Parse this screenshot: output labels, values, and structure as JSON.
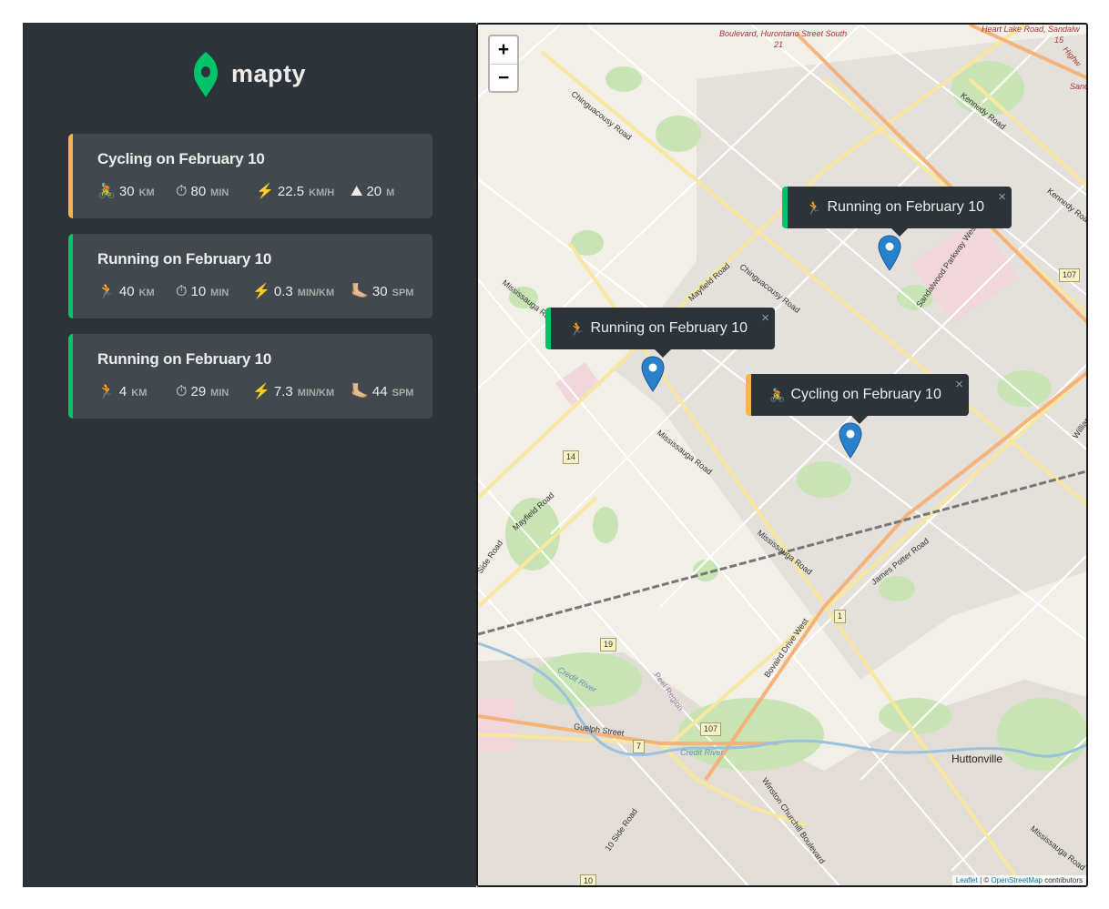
{
  "app": {
    "name": "mapty"
  },
  "workouts": [
    {
      "type": "cycling",
      "title": "Cycling on February 10",
      "details": [
        {
          "icon": "🚴",
          "value": "30",
          "unit": "km"
        },
        {
          "icon": "⏱",
          "value": "80",
          "unit": "min"
        },
        {
          "icon": "⚡️",
          "value": "22.5",
          "unit": "km/h"
        },
        {
          "icon": "⛰",
          "value": "20",
          "unit": "m"
        }
      ]
    },
    {
      "type": "running",
      "title": "Running on February 10",
      "details": [
        {
          "icon": "🏃",
          "value": "40",
          "unit": "km"
        },
        {
          "icon": "⏱",
          "value": "10",
          "unit": "min"
        },
        {
          "icon": "⚡️",
          "value": "0.3",
          "unit": "min/km"
        },
        {
          "icon": "🦶🏼",
          "value": "30",
          "unit": "spm"
        }
      ]
    },
    {
      "type": "running",
      "title": "Running on February 10",
      "details": [
        {
          "icon": "🏃",
          "value": "4",
          "unit": "km"
        },
        {
          "icon": "⏱",
          "value": "29",
          "unit": "min"
        },
        {
          "icon": "⚡️",
          "value": "7.3",
          "unit": "min/km"
        },
        {
          "icon": "🦶🏼",
          "value": "44",
          "unit": "spm"
        }
      ]
    }
  ],
  "map": {
    "zoom_in": "+",
    "zoom_out": "−",
    "popups": [
      {
        "type": "running",
        "icon": "🏃",
        "text": "Running on February 10",
        "close": "×"
      },
      {
        "type": "running",
        "icon": "🏃",
        "text": "Running on February 10",
        "close": "×"
      },
      {
        "type": "cycling",
        "icon": "🚴",
        "text": "Cycling on February 10",
        "close": "×"
      }
    ],
    "labels": {
      "chinguacousy": "Chinguacousy Road",
      "chinguacousy2": "Chinguacousy Road",
      "mayfield": "Mayfield Road",
      "mayfield2": "Mayfield Road",
      "mississauga1": "Mississauga Road",
      "mississauga2": "Mississauga Road",
      "mississauga3": "Mississauga Road",
      "mississauga4": "Mississauga Road",
      "kennedy": "Kennedy Road",
      "kennedy2": "Kennedy Road",
      "sandalwood": "Sandalwood Parkway West",
      "williams": "Williams Parkway",
      "james_potter": "James Potter Road",
      "bovaird": "Bovaird Drive West",
      "guelph": "Guelph Street",
      "winston": "Winston Churchill Boulevard",
      "tenth_side": "10 Side Road",
      "credit_river": "Credit River",
      "credit_river2": "Credit River",
      "peel_region": "Peel Region",
      "hurontario": "Boulevard, Hurontario Street South",
      "heart_lake": "Heart Lake Road, Sandalw",
      "side_road": "Side Road",
      "huttonville": "Huttonville",
      "s21": "21",
      "s15": "15",
      "sand": "Sand",
      "highway": "Highw"
    },
    "shields": {
      "r107a": "107",
      "r107b": "107",
      "r14": "14",
      "r19": "19",
      "r1": "1",
      "r7": "7",
      "r10": "10"
    },
    "attribution": {
      "leaflet": "Leaflet",
      "sep": " | © ",
      "osm": "OpenStreetMap",
      "contrib": " contributors"
    }
  }
}
